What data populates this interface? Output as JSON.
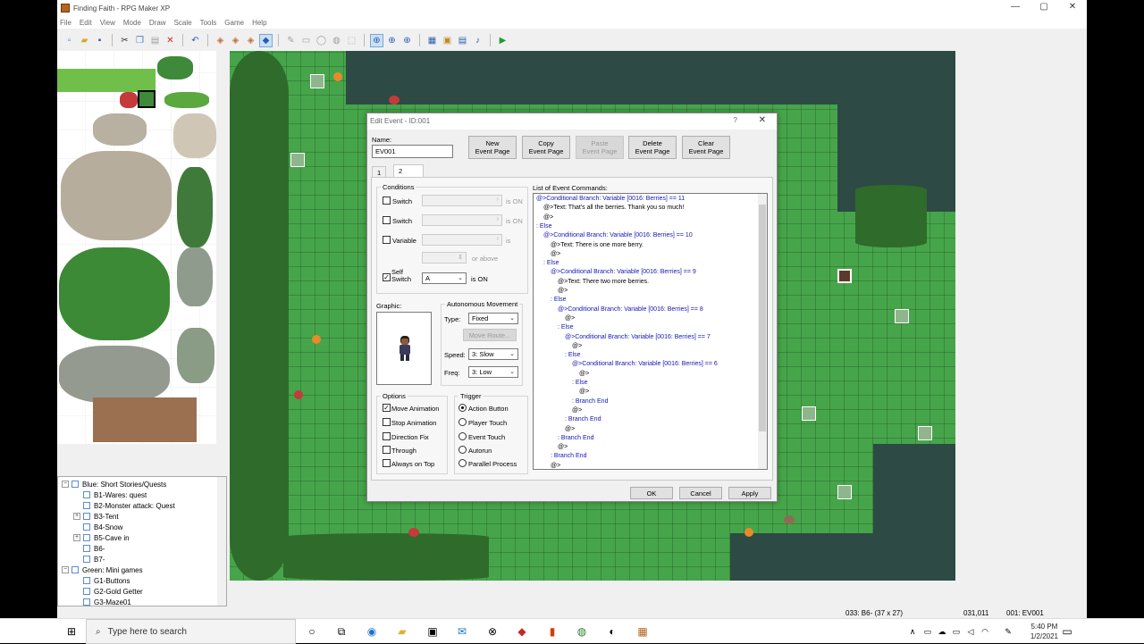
{
  "window": {
    "title": "Finding Faith - RPG Maker XP",
    "minimize": "—",
    "maximize": "▢",
    "close": "✕"
  },
  "menu": [
    "File",
    "Edit",
    "View",
    "Mode",
    "Draw",
    "Scale",
    "Tools",
    "Game",
    "Help"
  ],
  "tree": {
    "items": [
      {
        "label": "Blue: Short Stories/Quests",
        "expander": "−"
      },
      {
        "label": "B1-Wares: quest",
        "expander": ""
      },
      {
        "label": "B2-Monster attack: Quest",
        "expander": ""
      },
      {
        "label": "B3-Tent",
        "expander": "+"
      },
      {
        "label": "B4-Snow",
        "expander": ""
      },
      {
        "label": "B5-Cave in",
        "expander": "+"
      },
      {
        "label": "B6-",
        "expander": ""
      },
      {
        "label": "B7-",
        "expander": ""
      },
      {
        "label": "Green: Mini games",
        "expander": "−"
      },
      {
        "label": "G1-Buttons",
        "expander": ""
      },
      {
        "label": "G2-Gold Getter",
        "expander": ""
      },
      {
        "label": "G3-Maze01",
        "expander": ""
      }
    ]
  },
  "status": {
    "map_info": "033: B6- (37 x 27)",
    "coords": "031,011",
    "event": "001: EV001"
  },
  "dialog": {
    "title": "Edit Event - ID:001",
    "help": "?",
    "close": "✕",
    "name_label": "Name:",
    "name_value": "EV001",
    "buttons": {
      "new_page": [
        "New",
        "Event Page"
      ],
      "copy_page": [
        "Copy",
        "Event Page"
      ],
      "paste_page": [
        "Paste",
        "Event Page"
      ],
      "delete_page": [
        "Delete",
        "Event Page"
      ],
      "clear_page": [
        "Clear",
        "Event Page"
      ]
    },
    "tabs": [
      "1",
      "2"
    ],
    "conditions": {
      "title": "Conditions",
      "switch1": "Switch",
      "switch2": "Switch",
      "variable": "Variable",
      "is_on": "is ON",
      "is": "is",
      "or_above": "or above",
      "self_switch": "Self Switch",
      "self_switch_value": "A"
    },
    "graphic_label": "Graphic:",
    "autonomous": {
      "title": "Autonomous Movement",
      "type_label": "Type:",
      "type_value": "Fixed",
      "move_route": "Move Route...",
      "speed_label": "Speed:",
      "speed_value": "3: Slow",
      "freq_label": "Freq:",
      "freq_value": "3: Low"
    },
    "options": {
      "title": "Options",
      "items": [
        {
          "label": "Move Animation",
          "checked": true
        },
        {
          "label": "Stop Animation",
          "checked": false
        },
        {
          "label": "Direction Fix",
          "checked": false
        },
        {
          "label": "Through",
          "checked": false
        },
        {
          "label": "Always on Top",
          "checked": false
        }
      ]
    },
    "trigger": {
      "title": "Trigger",
      "items": [
        {
          "label": "Action Button",
          "selected": true
        },
        {
          "label": "Player Touch",
          "selected": false
        },
        {
          "label": "Event Touch",
          "selected": false
        },
        {
          "label": "Autorun",
          "selected": false
        },
        {
          "label": "Parallel Process",
          "selected": false
        }
      ]
    },
    "commands_label": "List of Event Commands:",
    "commands": [
      {
        "text": "@>Conditional Branch: Variable [0016: Berries] == 11",
        "indent": 0,
        "blue": true
      },
      {
        "text": "@>Text: That's all the berries. Thank you so much!",
        "indent": 1,
        "blue": false
      },
      {
        "text": "@>",
        "indent": 1,
        "blue": false
      },
      {
        "text": ": Else",
        "indent": 0,
        "blue": true
      },
      {
        "text": "@>Conditional Branch: Variable [0016: Berries] == 10",
        "indent": 1,
        "blue": true
      },
      {
        "text": "@>Text: There is one more berry.",
        "indent": 2,
        "blue": false
      },
      {
        "text": "@>",
        "indent": 2,
        "blue": false
      },
      {
        "text": ": Else",
        "indent": 1,
        "blue": true
      },
      {
        "text": "@>Conditional Branch: Variable [0016: Berries] == 9",
        "indent": 2,
        "blue": true
      },
      {
        "text": "@>Text: There two more berries.",
        "indent": 3,
        "blue": false
      },
      {
        "text": "@>",
        "indent": 3,
        "blue": false
      },
      {
        "text": ": Else",
        "indent": 2,
        "blue": true
      },
      {
        "text": "@>Conditional Branch: Variable [0016: Berries] == 8",
        "indent": 3,
        "blue": true
      },
      {
        "text": "@>",
        "indent": 4,
        "blue": false
      },
      {
        "text": ": Else",
        "indent": 3,
        "blue": true
      },
      {
        "text": "@>Conditional Branch: Variable [0016: Berries] == 7",
        "indent": 4,
        "blue": true
      },
      {
        "text": "@>",
        "indent": 5,
        "blue": false
      },
      {
        "text": ": Else",
        "indent": 4,
        "blue": true
      },
      {
        "text": "@>Conditional Branch: Variable [0016: Berries] == 6",
        "indent": 5,
        "blue": true
      },
      {
        "text": "@>",
        "indent": 6,
        "blue": false
      },
      {
        "text": ": Else",
        "indent": 5,
        "blue": true
      },
      {
        "text": "@>",
        "indent": 6,
        "blue": false
      },
      {
        "text": ": Branch End",
        "indent": 5,
        "blue": true
      },
      {
        "text": "@>",
        "indent": 5,
        "blue": false
      },
      {
        "text": ": Branch End",
        "indent": 4,
        "blue": true
      },
      {
        "text": "@>",
        "indent": 4,
        "blue": false
      },
      {
        "text": ": Branch End",
        "indent": 3,
        "blue": true
      },
      {
        "text": "@>",
        "indent": 3,
        "blue": false
      },
      {
        "text": ": Branch End",
        "indent": 2,
        "blue": true
      },
      {
        "text": "@>",
        "indent": 2,
        "blue": false
      }
    ],
    "ok": "OK",
    "cancel": "Cancel",
    "apply": "Apply"
  },
  "taskbar": {
    "search_placeholder": "Type here to search",
    "time": "5:40 PM",
    "date": "1/2/2021"
  },
  "icons": {
    "toolbar": [
      "new-project-icon",
      "open-project-icon",
      "save-icon",
      "cut-icon",
      "copy-icon",
      "paste-icon",
      "delete-icon",
      "undo-icon",
      "layer1-icon",
      "layer2-icon",
      "layer3-icon",
      "events-layer-icon",
      "pencil-icon",
      "rectangle-icon",
      "ellipse-icon",
      "fill-icon",
      "select-icon",
      "zoom-1-icon",
      "zoom-2-icon",
      "zoom-4-icon",
      "database-icon",
      "materialbase-icon",
      "script-editor-icon",
      "sound-test-icon",
      "playtest-icon"
    ]
  }
}
